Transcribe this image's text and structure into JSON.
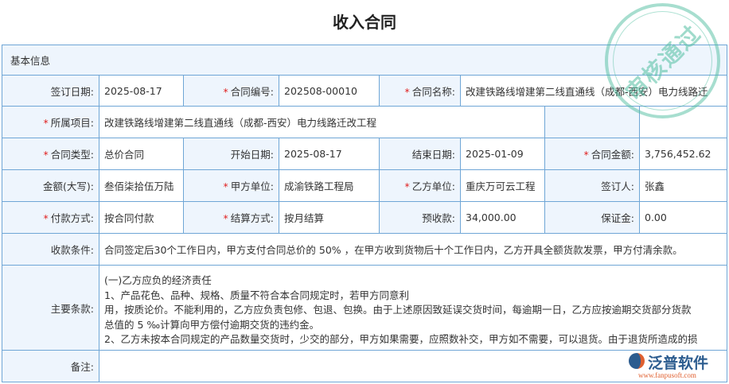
{
  "title": "收入合同",
  "section": "基本信息",
  "fields": {
    "sign_date": {
      "label": "签订日期:",
      "value": "2025-08-17"
    },
    "contract_no": {
      "label": "合同编号:",
      "value": "202508-00010"
    },
    "contract_name": {
      "label": "合同名称:",
      "value": "改建铁路线增建第二线直通线（成都-西安）电力线路迁"
    },
    "project": {
      "label": "所属项目:",
      "value": "改建铁路线增建第二线直通线（成都-西安）电力线路迁改工程"
    },
    "type": {
      "label": "合同类型:",
      "value": "总价合同"
    },
    "start_date": {
      "label": "开始日期:",
      "value": "2025-08-17"
    },
    "end_date": {
      "label": "结束日期:",
      "value": "2025-01-09"
    },
    "amount": {
      "label": "合同金额:",
      "value": "3,756,452.62"
    },
    "amount_upper": {
      "label": "金额(大写):",
      "value": "叁佰柒拾伍万陆"
    },
    "party_a": {
      "label": "甲方单位:",
      "value": "成渝铁路工程局"
    },
    "party_b": {
      "label": "乙方单位:",
      "value": "重庆万可云工程"
    },
    "signer": {
      "label": "签订人:",
      "value": "张鑫"
    },
    "pay_method": {
      "label": "付款方式:",
      "value": "按合同付款"
    },
    "settle_method": {
      "label": "结算方式:",
      "value": "按月结算"
    },
    "advance": {
      "label": "预收款:",
      "value": "34,000.00"
    },
    "deposit": {
      "label": "保证金:",
      "value": "0.00"
    },
    "terms": {
      "label": "收款条件:",
      "value": "合同签定后30个工作日内，甲方支付合同总价的 50% ，在甲方收到货物后十个工作日内，乙方开具全额货款发票，甲方付清余款。"
    },
    "main_terms": {
      "label": "主要条款:",
      "lines": [
        "(一)乙方应负的经济责任",
        "1、产品花色、品种、规格、质量不符合本合同规定时，若甲方同意利",
        "用，按质论价。不能利用的，乙方应负责包修、包退、包换。由于上述原因致延误交货时间，每逾期一日，乙方应按逾期交货部分货款",
        "总值的 5 ‰计算向甲方偿付逾期交货的违约金。",
        "2、乙方未按本合同规定的产品数量交货时，少交的部分，甲方如果需要，应照数补交，甲方如不需要，可以退货。由于退货所造成的损"
      ]
    },
    "remark": {
      "label": "备注:",
      "value": ""
    }
  },
  "stamp": "审核通过",
  "logo": {
    "name": "泛普软件",
    "url": "www.fanpusoft.com"
  }
}
